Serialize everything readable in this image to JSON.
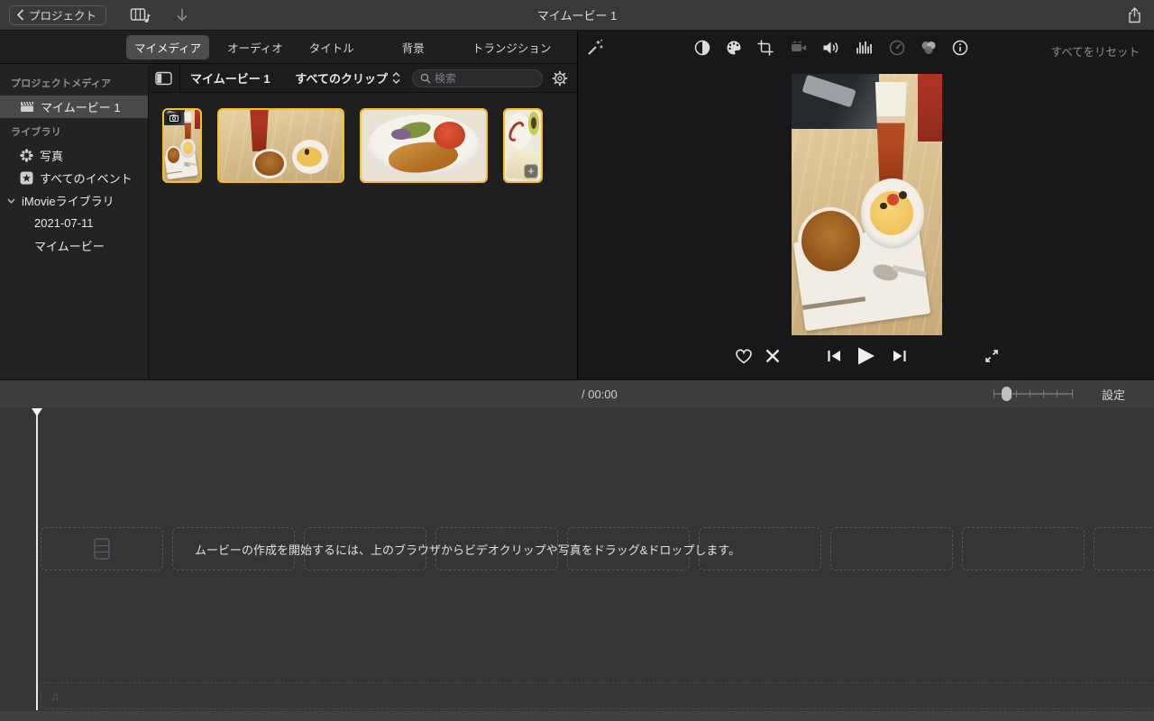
{
  "titlebar": {
    "back_label": "プロジェクト",
    "title": "マイムービー 1"
  },
  "tabs": {
    "my_media": "マイメディア",
    "audio": "オーディオ",
    "titles": "タイトル",
    "backgrounds": "背景",
    "transitions": "トランジション"
  },
  "sidebar": {
    "project_media_header": "プロジェクトメディア",
    "my_movie_item": "マイムービー 1",
    "library_header": "ライブラリ",
    "photos": "写真",
    "all_events": "すべてのイベント",
    "imovie_library": "iMovieライブラリ",
    "event_2021": "2021-07-11",
    "my_movie_event": "マイムービー"
  },
  "browser": {
    "title": "マイムービー 1",
    "filter": "すべてのクリップ",
    "search_placeholder": "検索",
    "clip_count": 4
  },
  "viewer": {
    "reset_label": "すべてをリセット"
  },
  "timeline_toolbar": {
    "duration": "/ 00:00",
    "settings": "設定"
  },
  "timeline": {
    "hint": "ムービーの作成を開始するには、上のブラウザからビデオクリップや写真をドラッグ&ドロップします。"
  },
  "icons": {
    "music_track_note": "♫",
    "plus_badge": "+"
  },
  "colors": {
    "selection_yellow": "#f7c01d",
    "titlebar_bg": "#39393b",
    "timeline_bg": "#353537",
    "viewer_bg": "#18181a"
  }
}
